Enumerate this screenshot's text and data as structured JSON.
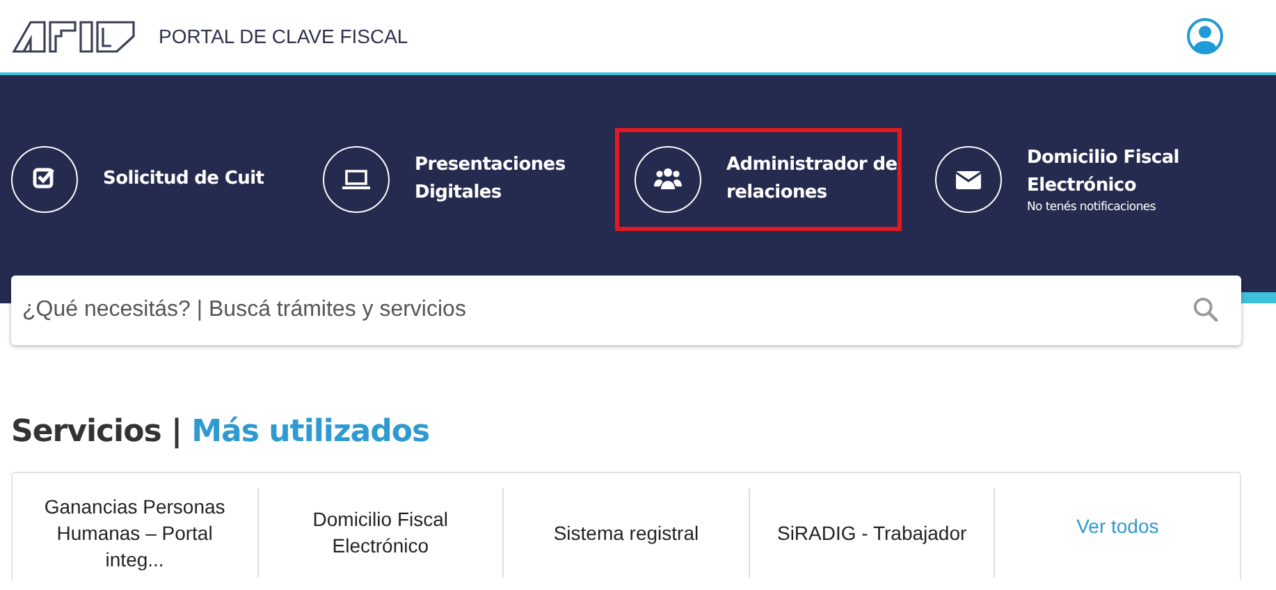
{
  "header": {
    "portal_title": "PORTAL DE CLAVE FISCAL"
  },
  "shortcuts": [
    {
      "kind": "check",
      "label": "Solicitud de Cuit",
      "highlighted": false
    },
    {
      "kind": "laptop",
      "label": "Presentaciones Digitales",
      "highlighted": false
    },
    {
      "kind": "users",
      "label": "Administrador de relaciones",
      "highlighted": true
    },
    {
      "kind": "mail",
      "label": "Domicilio Fiscal Electrónico",
      "note": "No tenés notificaciones",
      "highlighted": false
    }
  ],
  "search": {
    "placeholder": "¿Qué necesitás? | Buscá trámites y servicios"
  },
  "services": {
    "title": "Servicios |",
    "subtitle": "Más utilizados",
    "items": [
      {
        "kind": "service",
        "label": "Ganancias Personas Humanas – Portal integ..."
      },
      {
        "kind": "service",
        "label": "Domicilio Fiscal Electrónico"
      },
      {
        "kind": "service",
        "label": "Sistema registral"
      },
      {
        "kind": "service",
        "label": "SiRADIG - Trabajador"
      },
      {
        "kind": "link",
        "label": "Ver todos"
      }
    ]
  }
}
